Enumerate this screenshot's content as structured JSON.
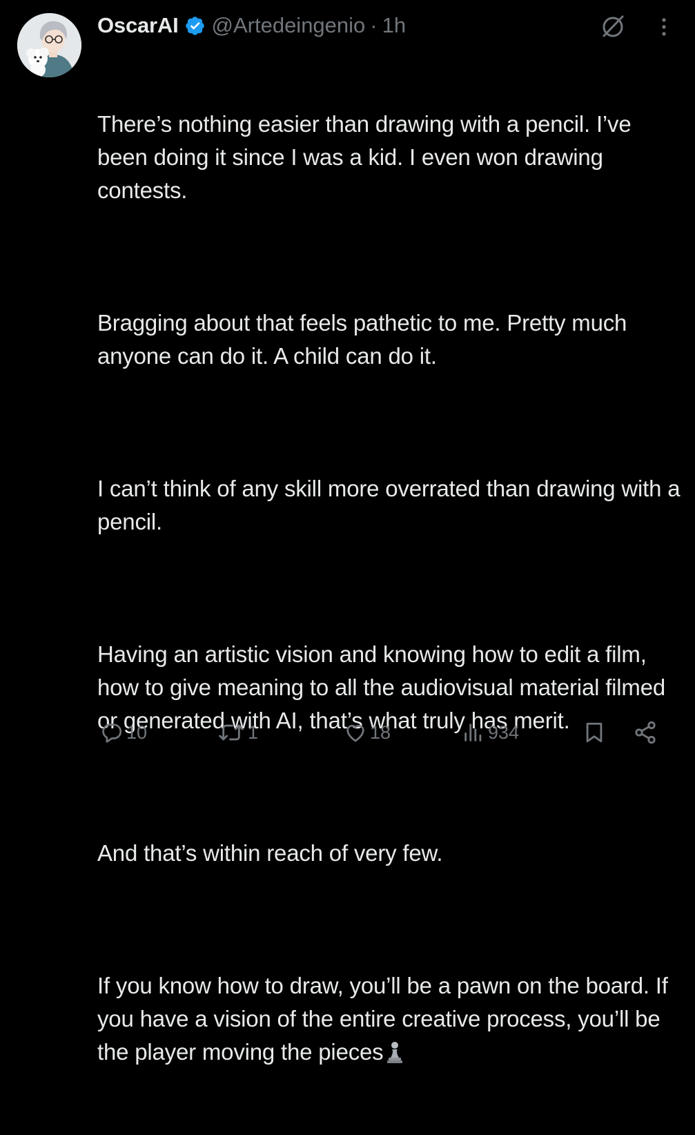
{
  "post": {
    "author": {
      "display_name": "OscarAI",
      "verified": true,
      "handle": "@Artedeingenio",
      "separator": "·",
      "time": "1h",
      "avatar_icon": "avatar-illustrated-person-with-dog"
    },
    "header_icons": {
      "grok": "grok-icon",
      "more": "more-options-icon"
    },
    "paragraphs": [
      "There’s nothing easier than drawing with a pencil. I’ve been doing it since I was a kid. I even won drawing contests.",
      "Bragging about that feels pathetic to me. Pretty much anyone can do it. A child can do it.",
      "I can’t think of any skill more overrated than drawing with a pencil.",
      "Having an artistic vision and knowing how to edit a film, how to give meaning to all the audiovisual material filmed or generated with AI, that’s what truly has merit.",
      "And that’s within reach of very few.",
      "If you know how to draw, you’ll be a pawn on the board. If you have a vision of the entire creative process, you’ll be the player moving the pieces"
    ],
    "trailing_emoji_icon": "chess-pawn-icon",
    "actions": {
      "replies": "10",
      "reposts": "1",
      "likes": "18",
      "views": "934"
    }
  },
  "colors": {
    "background": "#000000",
    "text": "#e7e9ea",
    "secondary_text": "#71767b",
    "verified_badge": "#1d9bf0"
  }
}
